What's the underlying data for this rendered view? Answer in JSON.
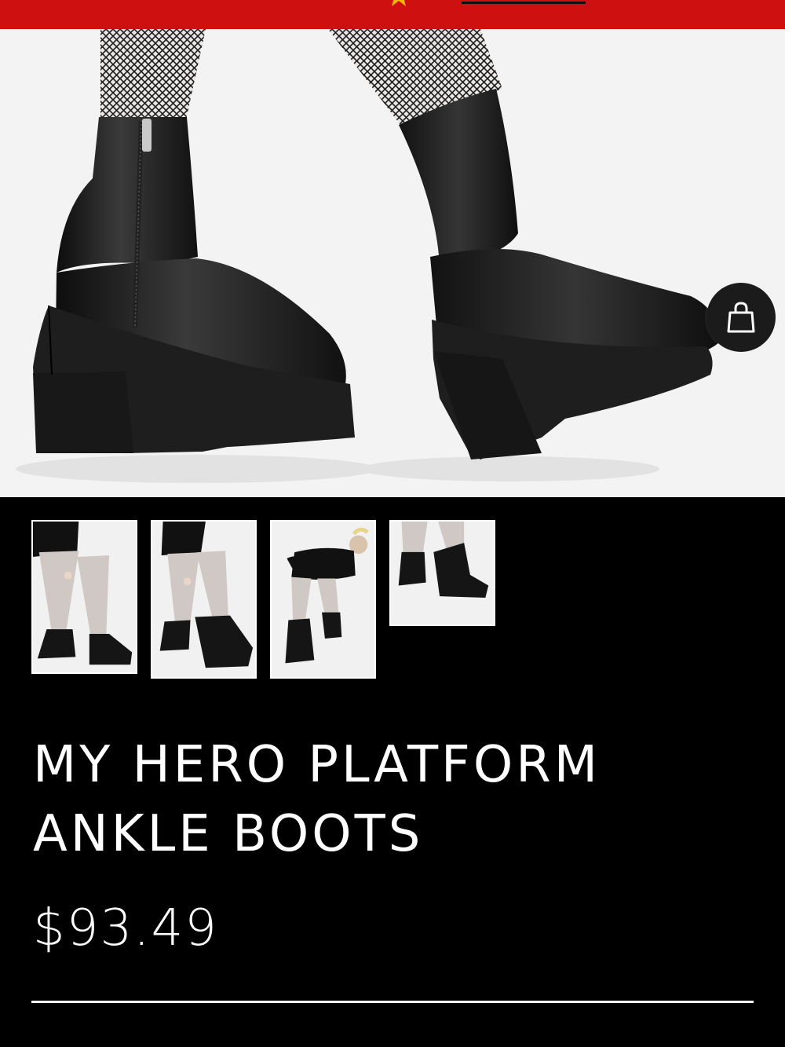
{
  "product": {
    "name": "MY HERO PLATFORM ANKLE BOOTS",
    "price": "$93.49"
  },
  "gallery": {
    "thumbnail_count": 4
  },
  "icons": {
    "cart": "shopping-bag-icon",
    "promo": "star-icon"
  },
  "colors": {
    "promo_bar": "#cf1010",
    "page_background": "#000000",
    "text": "#ffffff",
    "cart_button": "#1b1b1b",
    "promo_star": "#f5b800"
  }
}
